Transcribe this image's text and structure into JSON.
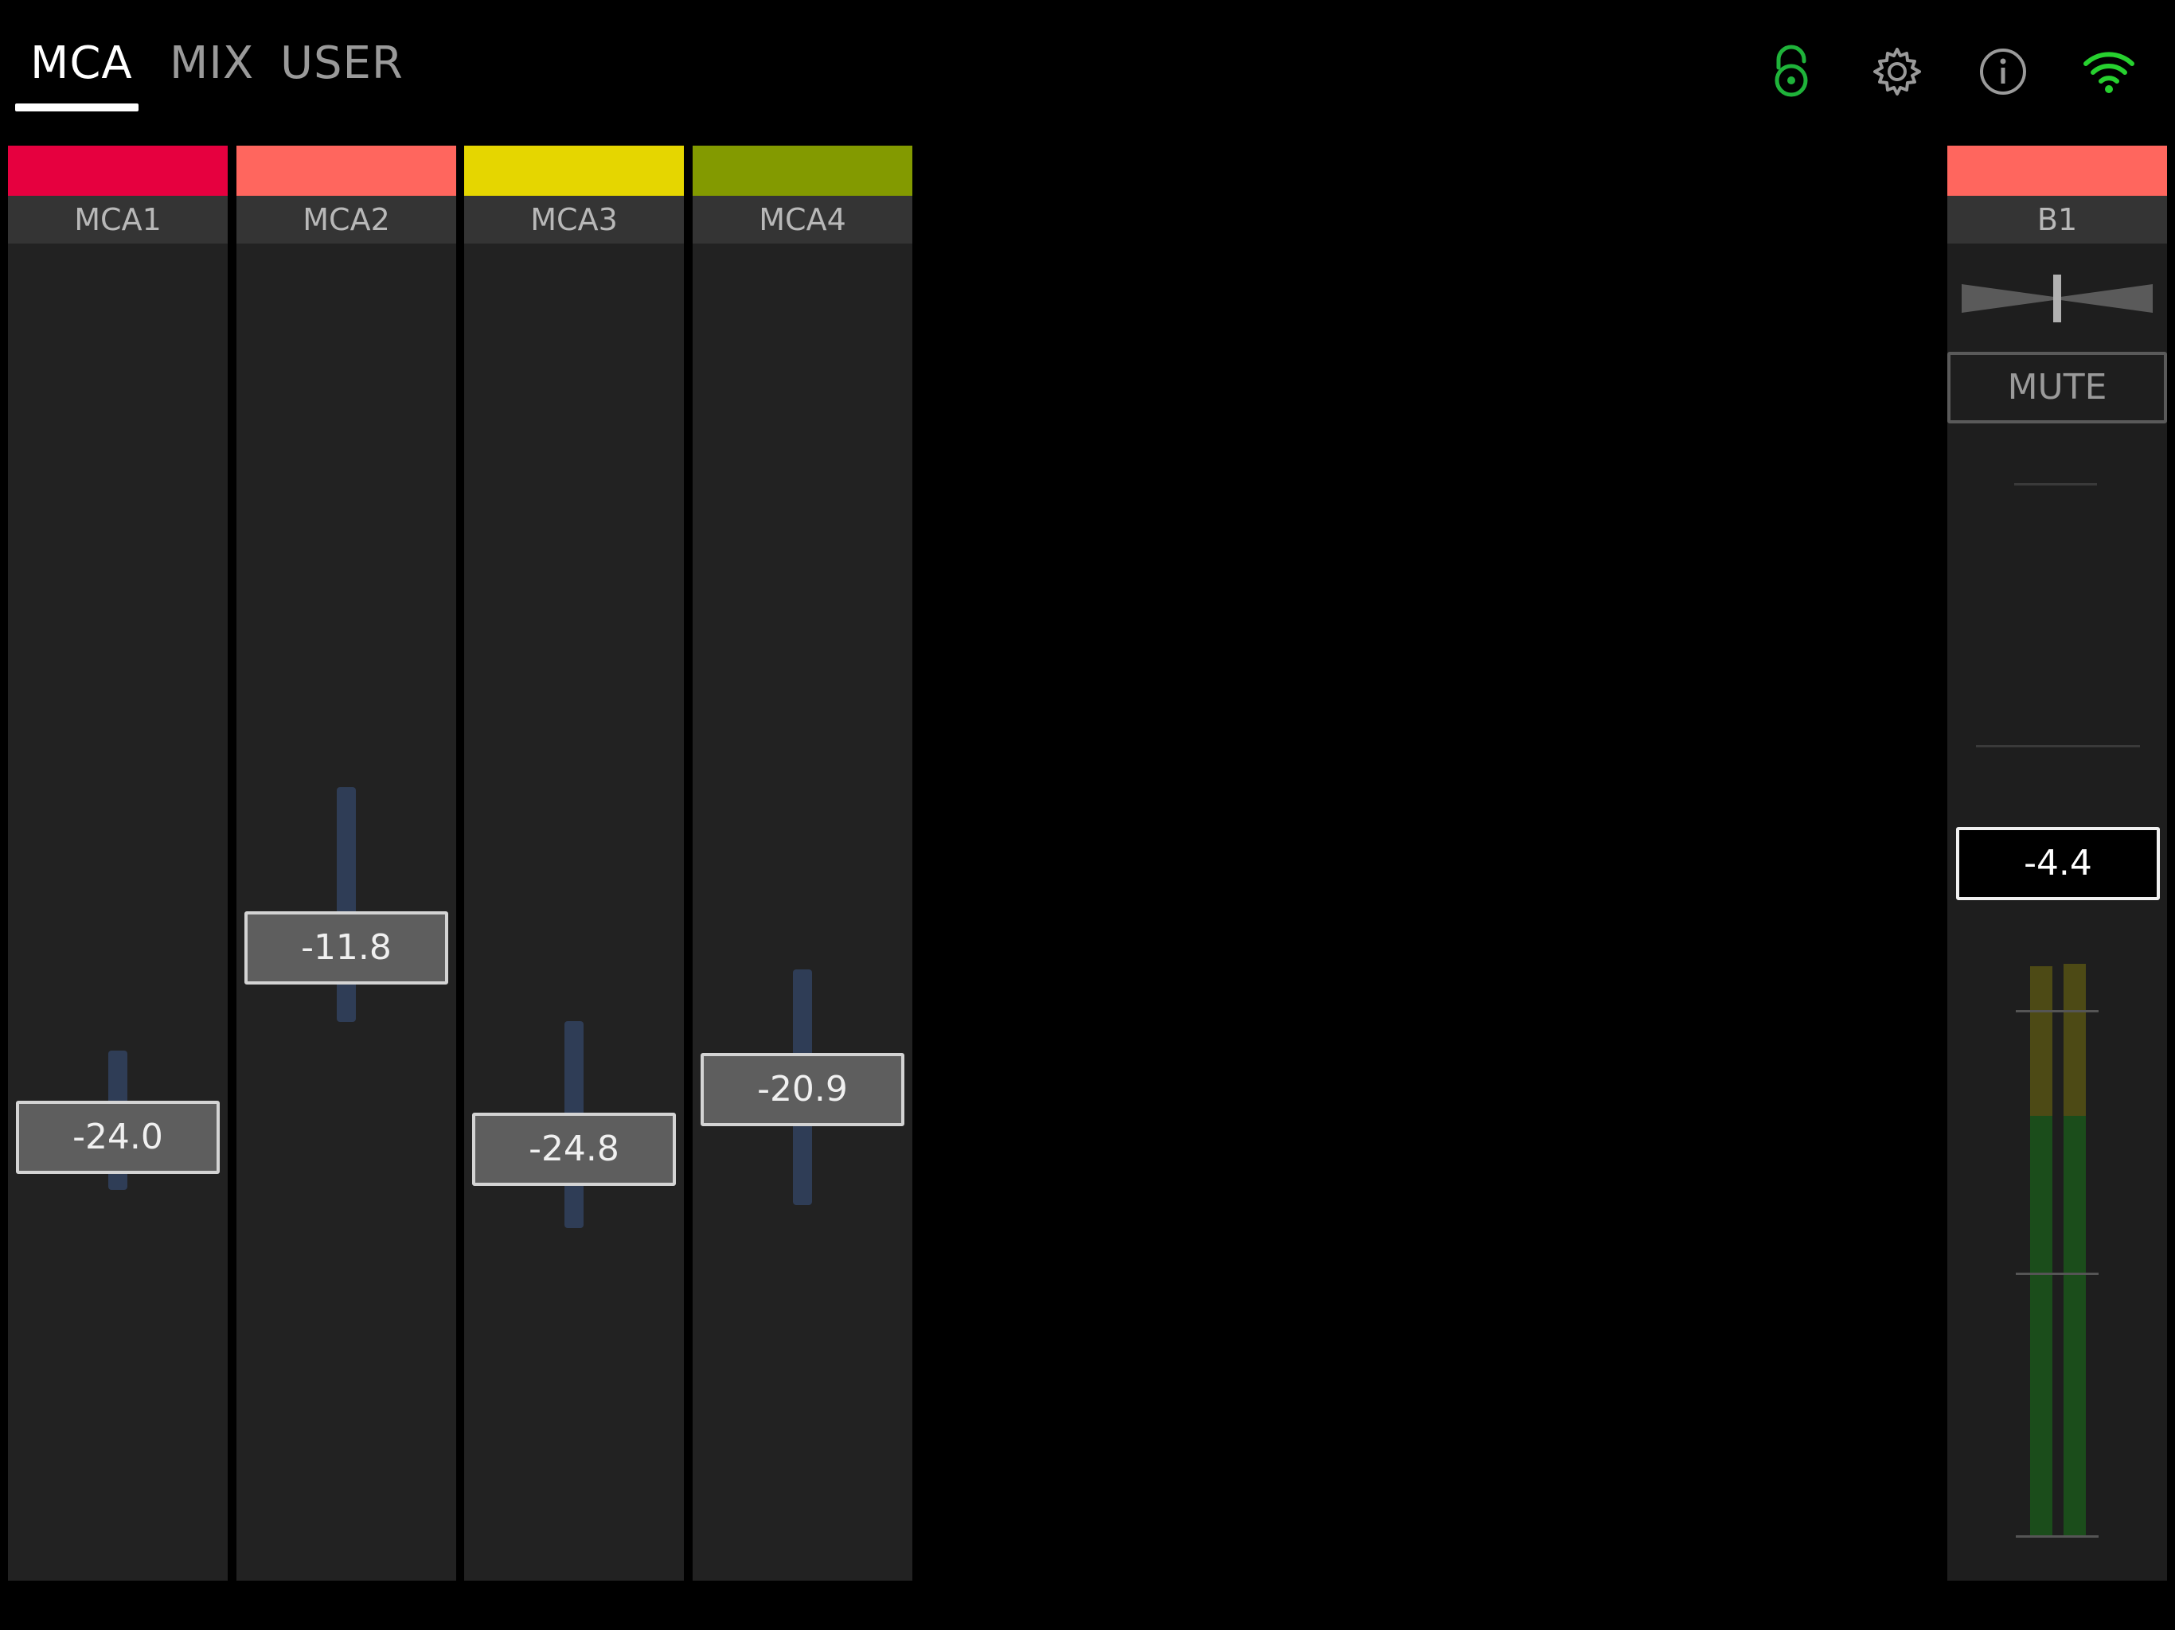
{
  "tabs": [
    {
      "label": "MCA",
      "active": true
    },
    {
      "label": "MIX",
      "active": false
    },
    {
      "label": "USER",
      "active": false
    }
  ],
  "toolbar": {
    "icons": [
      "lock-open-icon",
      "gear-icon",
      "info-icon",
      "wifi-icon"
    ],
    "lock_color": "#1fb33a",
    "wifi_color": "#27d12f"
  },
  "channels": [
    {
      "name": "MCA1",
      "color": "#e6003f",
      "value": "-24.0"
    },
    {
      "name": "MCA2",
      "color": "#ff665e",
      "value": "-11.8"
    },
    {
      "name": "MCA3",
      "color": "#e5d600",
      "value": "-24.8"
    },
    {
      "name": "MCA4",
      "color": "#839a00",
      "value": "-20.9"
    }
  ],
  "master": {
    "name": "B1",
    "color": "#ff665e",
    "mute_label": "MUTE",
    "value": "-4.4"
  }
}
